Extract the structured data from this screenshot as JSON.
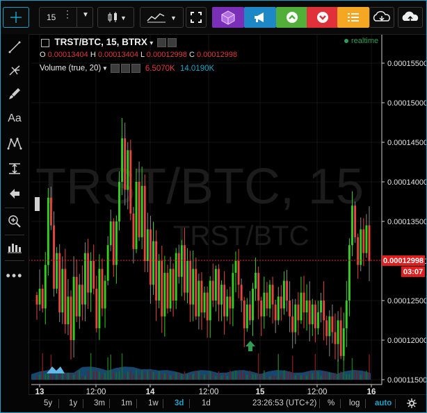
{
  "toolbar": {
    "interval": "15",
    "buttons": [
      "crosshair-icon",
      "interval-menu",
      "candles-icon",
      "indicators-icon",
      "fullscreen-icon",
      "cube-icon",
      "megaphone-icon",
      "up-icon",
      "down-icon",
      "list-icon",
      "cloud-download-icon",
      "cloud-upload-icon"
    ]
  },
  "legend": {
    "symbol": "TRST/BTC, 15, BTRX",
    "realtime": "realtime",
    "o_key": "O",
    "o_val": "0.00013404",
    "h_key": "H",
    "h_val": "0.00013404",
    "l_key": "L",
    "l_val": "0.00012998",
    "c_key": "C",
    "c_val": "0.00012998",
    "volume_label": "Volume (true, 20)",
    "volume_val1": "6.5070K",
    "volume_val2": "14.0190K"
  },
  "watermark": {
    "line1": "TRST/BTC, 15",
    "line2": "TRST/BTC"
  },
  "colors": {
    "up": "#35d11f",
    "down": "#e8453c",
    "price_line": "#e01e1e",
    "volume": "#2a7fc0",
    "accent": "#1aa3c8"
  },
  "price_badge": "0.00012998",
  "time_badge": "03:07",
  "bottom": {
    "ranges": [
      "5y",
      "1y",
      "3m",
      "1m",
      "1w",
      "3d",
      "1d"
    ],
    "active_range": "3d",
    "clock": "23:26:53 (UTC+2)",
    "percent": "%",
    "log": "log",
    "auto": "auto"
  },
  "chart_data": {
    "type": "candlestick",
    "x_ticks": [
      "13",
      "12:00",
      "14",
      "12:00",
      "15",
      "12:00",
      "16"
    ],
    "y_ticks": [
      "0.00011500",
      "0.00012000",
      "0.00012500",
      "0.00013000",
      "0.00013500",
      "0.00014000",
      "0.00014500",
      "0.00015000",
      "0.00015500"
    ],
    "ylim": [
      0.000114,
      0.00016
    ],
    "last_price": 0.00012998,
    "close_path": [
      0.0001245,
      0.0001265,
      0.000124,
      0.0001295,
      0.000138,
      0.0001345,
      0.0001265,
      0.000131,
      0.0001235,
      0.000129,
      0.000122,
      0.0001255,
      0.00012,
      0.000128,
      0.000123,
      0.000127,
      0.0001245,
      0.000131,
      0.000126,
      0.00013,
      0.0001265,
      0.0001215,
      0.000129,
      0.000124,
      0.0001275,
      0.000132,
      0.000135,
      0.0001295,
      0.000135,
      0.00014,
      0.0001455,
      0.000139,
      0.000144,
      0.000136,
      0.0001315,
      0.00014,
      0.000133,
      0.0001395,
      0.00013,
      0.000134,
      0.000127,
      0.0001325,
      0.000125,
      0.00013,
      0.000123,
      0.0001285,
      0.000124,
      0.000129,
      0.000125,
      0.000131,
      0.000128,
      0.000132,
      0.000126,
      0.00013,
      0.0001245,
      0.000129,
      0.000123,
      0.0001275,
      0.0001235,
      0.000126,
      0.0001225,
      0.0001275,
      0.000125,
      0.000129,
      0.0001245,
      0.000127,
      0.000123,
      0.0001255,
      0.000124,
      0.0001285,
      0.00013,
      0.000127,
      0.000125,
      0.0001215,
      0.0001245,
      0.0001225,
      0.0001265,
      0.0001285,
      0.000125,
      0.000123,
      0.000126,
      0.000124,
      0.000127,
      0.0001245,
      0.0001225,
      0.0001255,
      0.000124,
      0.0001275,
      0.000125,
      0.000123,
      0.000121,
      0.0001245,
      0.0001225,
      0.000126,
      0.0001235,
      0.000125,
      0.000122,
      0.0001245,
      0.0001215,
      0.0001235,
      0.000125,
      0.0001225,
      0.0001205,
      0.000123,
      0.000121,
      0.0001195,
      0.0001225,
      0.000118,
      0.0001215,
      0.000125,
      0.000132,
      0.000137,
      0.000133,
      0.0001295,
      0.000134,
      0.000131,
      0.0001345,
      0.00013
    ]
  }
}
